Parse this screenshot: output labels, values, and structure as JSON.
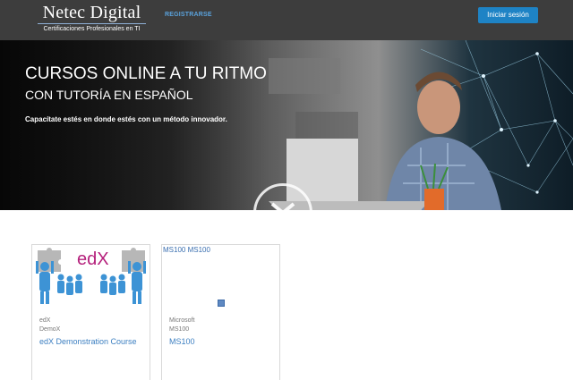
{
  "header": {
    "logo_main": "Netec Digital",
    "logo_sub": "Certificaciones Profesionales en TI",
    "register_label": "REGISTRARSE",
    "login_label": "Iniciar sesión",
    "background": "#3d3d3d",
    "accent": "#1e83c5"
  },
  "hero": {
    "title": "CURSOS ONLINE A TU RITMO",
    "subtitle": "CON TUTORÍA EN ESPAÑOL",
    "tagline": "Capacítate estés en donde estés con un método innovador.",
    "scroll_icon": "chevron-down-icon"
  },
  "courses": [
    {
      "logo_text": "edX",
      "org": "edX",
      "code": "DemoX",
      "title": "edX Demonstration Course"
    },
    {
      "thumb_label": "MS100 MS100",
      "org": "Microsoft",
      "code": "MS100",
      "title": "MS100"
    }
  ],
  "colors": {
    "link": "#3c7fc1",
    "edx_blue": "#3d93d5",
    "edx_magenta": "#b5217c"
  }
}
